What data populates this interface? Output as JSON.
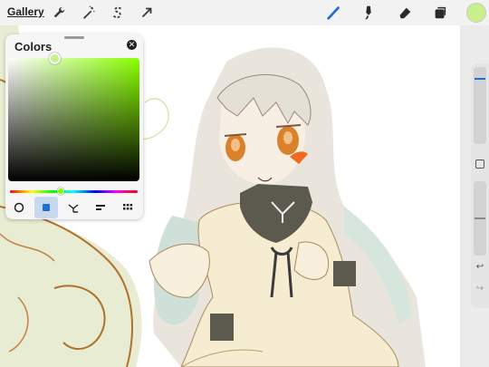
{
  "topbar": {
    "gallery_label": "Gallery",
    "left_tools": [
      "wrench-icon",
      "magic-wand-icon",
      "selection-s-icon",
      "transform-arrow-icon"
    ],
    "right_tools": [
      "brush-icon",
      "smudge-icon",
      "eraser-icon",
      "layers-icon"
    ],
    "current_color": "#c8f08a"
  },
  "color_panel": {
    "title": "Colors",
    "close_icon": "close-icon",
    "hue_color": "#8aff00",
    "selected_color": "#c8f08a",
    "active_tab": "classic",
    "tabs": [
      "disc",
      "classic",
      "harmony",
      "value",
      "palettes"
    ]
  },
  "sidebar": {
    "brush_size": 0.15,
    "opacity": 0.5,
    "tools": [
      "modify-square-icon",
      "undo-icon",
      "redo-icon"
    ]
  },
  "colors": {
    "accent": "#1f6fd1",
    "sketch_line": "#7a5a3a",
    "hair_tint": "#cfe0d8"
  }
}
